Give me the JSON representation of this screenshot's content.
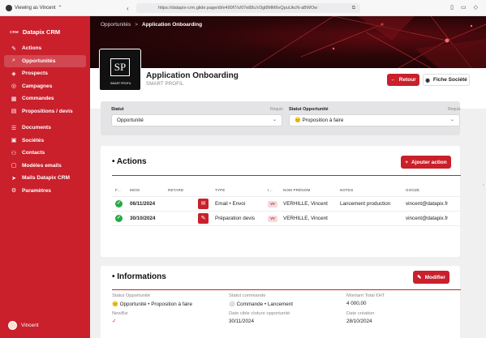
{
  "browser": {
    "viewing_label": "Viewing as Vincent",
    "url": "https://datapix-crm.glide.page/dl/e490f7/s/07e88c/r/3gl8MM6vQpuUkcN-aBWOw"
  },
  "sidebar": {
    "brand_logo": "CRM",
    "brand_name": "Datapix CRM",
    "items": [
      {
        "label": "Actions",
        "icon": "edit-icon",
        "glyph": "✎"
      },
      {
        "label": "Opportunités",
        "icon": "search-doc-icon",
        "glyph": "⌕"
      },
      {
        "label": "Prospects",
        "icon": "target-icon",
        "glyph": "◈"
      },
      {
        "label": "Campagnes",
        "icon": "campaign-icon",
        "glyph": "◎"
      },
      {
        "label": "Commandes",
        "icon": "grid-icon",
        "glyph": "▦"
      },
      {
        "label": "Propositions / devis",
        "icon": "document-icon",
        "glyph": "▤"
      },
      {
        "label": "Documents",
        "icon": "list-icon",
        "glyph": "☰"
      },
      {
        "label": "Sociétés",
        "icon": "building-icon",
        "glyph": "▣"
      },
      {
        "label": "Contacts",
        "icon": "users-icon",
        "glyph": "⚇"
      },
      {
        "label": "Modèles emails",
        "icon": "template-icon",
        "glyph": "▢"
      },
      {
        "label": "Mails Datapix CRM",
        "icon": "send-icon",
        "glyph": "➤"
      },
      {
        "label": "Paramètres",
        "icon": "gear-icon",
        "glyph": "⚙"
      }
    ],
    "user_name": "Vincent"
  },
  "breadcrumb": {
    "parent": "Opportunités",
    "separator": ">",
    "current": "Application Onboarding"
  },
  "record": {
    "logo_text": "SP",
    "logo_caption": "SMART PROFIL",
    "title": "Application Onboarding",
    "subtitle": "SMART PROFIL",
    "back_label": "Retour",
    "company_label": "Fiche Société"
  },
  "filters": {
    "statut_label": "Statut",
    "statut_required": "Requis",
    "statut_value": "Opportunité",
    "statut_opp_label": "Statut Opportunité",
    "statut_opp_required": "Requis",
    "statut_opp_value": "😐 Proposition à faire"
  },
  "actions": {
    "title": "• Actions",
    "add_label": "Ajouter action",
    "columns": [
      "F...",
      "MOIS",
      "RETARD",
      "TYPE",
      "I...",
      "NOM PRÉNOM",
      "NOTES",
      "GOOZE"
    ],
    "rows": [
      {
        "mois": "06/11/2024",
        "type": "Email • Envoi",
        "initials": "VV",
        "nom": "VERHILLE, Vincent",
        "notes": "Lancement production",
        "email": "vincent@datapix.fr",
        "type_icon": "email-icon"
      },
      {
        "mois": "30/10/2024",
        "type": "Préparation devis",
        "initials": "VV",
        "nom": "VERHILLE, Vincent",
        "notes": "",
        "email": "vincent@datapix.fr",
        "type_icon": "edit-doc-icon"
      }
    ]
  },
  "informations": {
    "title": "• Informations",
    "edit_label": "Modifier",
    "fields": [
      {
        "label": "Statut Opportunité",
        "value": "😐 Opportunité • Proposition à faire"
      },
      {
        "label": "Statut commande",
        "value": "⚪ Commande • Lancement"
      },
      {
        "label": "Montant Total €HT",
        "value": "4 000,00"
      },
      {
        "label": "NewBiz",
        "value": "✓"
      },
      {
        "label": "Date cible cloture opportunité",
        "value": "30/11/2024"
      },
      {
        "label": "Date création",
        "value": "28/10/2024"
      }
    ]
  },
  "colors": {
    "brand": "#c9202c",
    "success": "#27a844"
  }
}
